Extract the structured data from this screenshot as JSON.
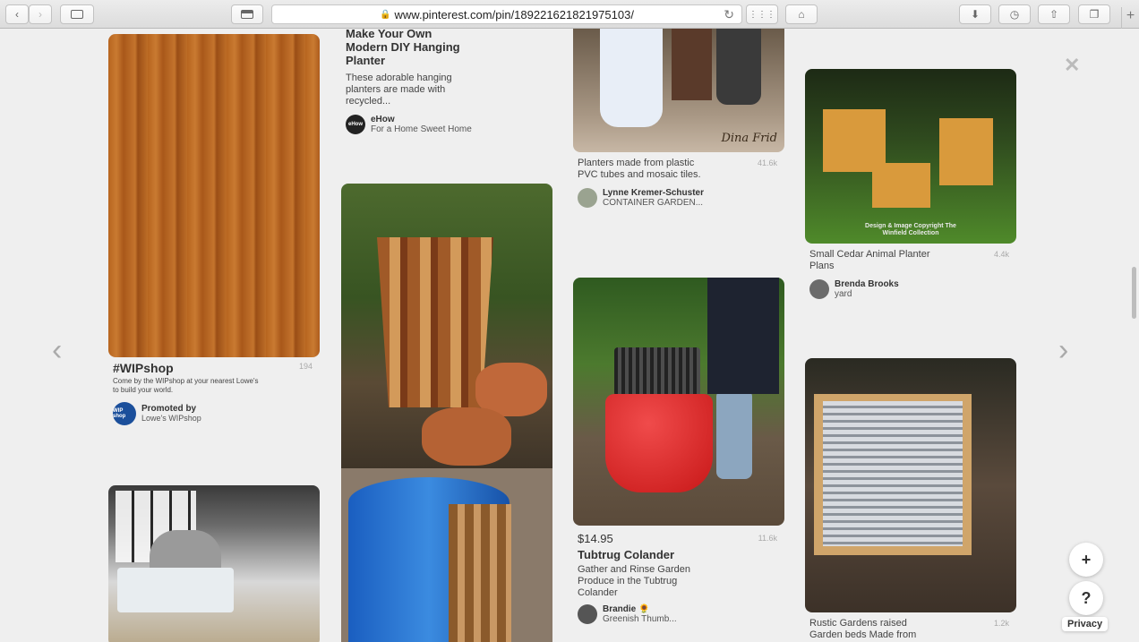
{
  "browser": {
    "url": "www.pinterest.com/pin/189221621821975103/",
    "new_tab": "+"
  },
  "overlay": {
    "prev_arrow": "‹",
    "next_arrow": "›",
    "close": "✕",
    "add_button": "+",
    "help_button": "?",
    "privacy": "Privacy"
  },
  "pins": [
    {
      "title": "#WIPshop",
      "saves": "194",
      "description": "Come by the WIPshop at your nearest Lowe's to build your world.",
      "user": "Promoted by",
      "board": "Lowe's WIPshop",
      "avatar": "WIP shop"
    },
    {
      "title": "Make Your Own Modern DIY Hanging Planter",
      "description": "These adorable hanging planters are made with recycled...",
      "user": "eHow",
      "board": "For a Home Sweet Home",
      "avatar": "eHow"
    },
    {
      "description": "Planters made from plastic PVC tubes and mosaic tiles.",
      "saves": "41.6k",
      "user": "Lynne Kremer-Schuster",
      "board": "CONTAINER GARDEN...",
      "watermark": "Dina Frid"
    },
    {
      "description": "Small Cedar Animal Planter Plans",
      "saves": "4.4k",
      "user": "Brenda Brooks",
      "board": "yard",
      "watermark": "Design & Image Copyright The Winfield Collection"
    },
    {
      "price": "$14.95",
      "title": "Tubtrug Colander",
      "description": "Gather and Rinse Garden Produce in the Tubtrug Colander",
      "saves": "11.6k",
      "user": "Brandie 🌻",
      "board": "Greenish Thumb..."
    },
    {
      "description": "Rustic Gardens raised Garden beds Made from",
      "saves": "1.2k"
    }
  ]
}
